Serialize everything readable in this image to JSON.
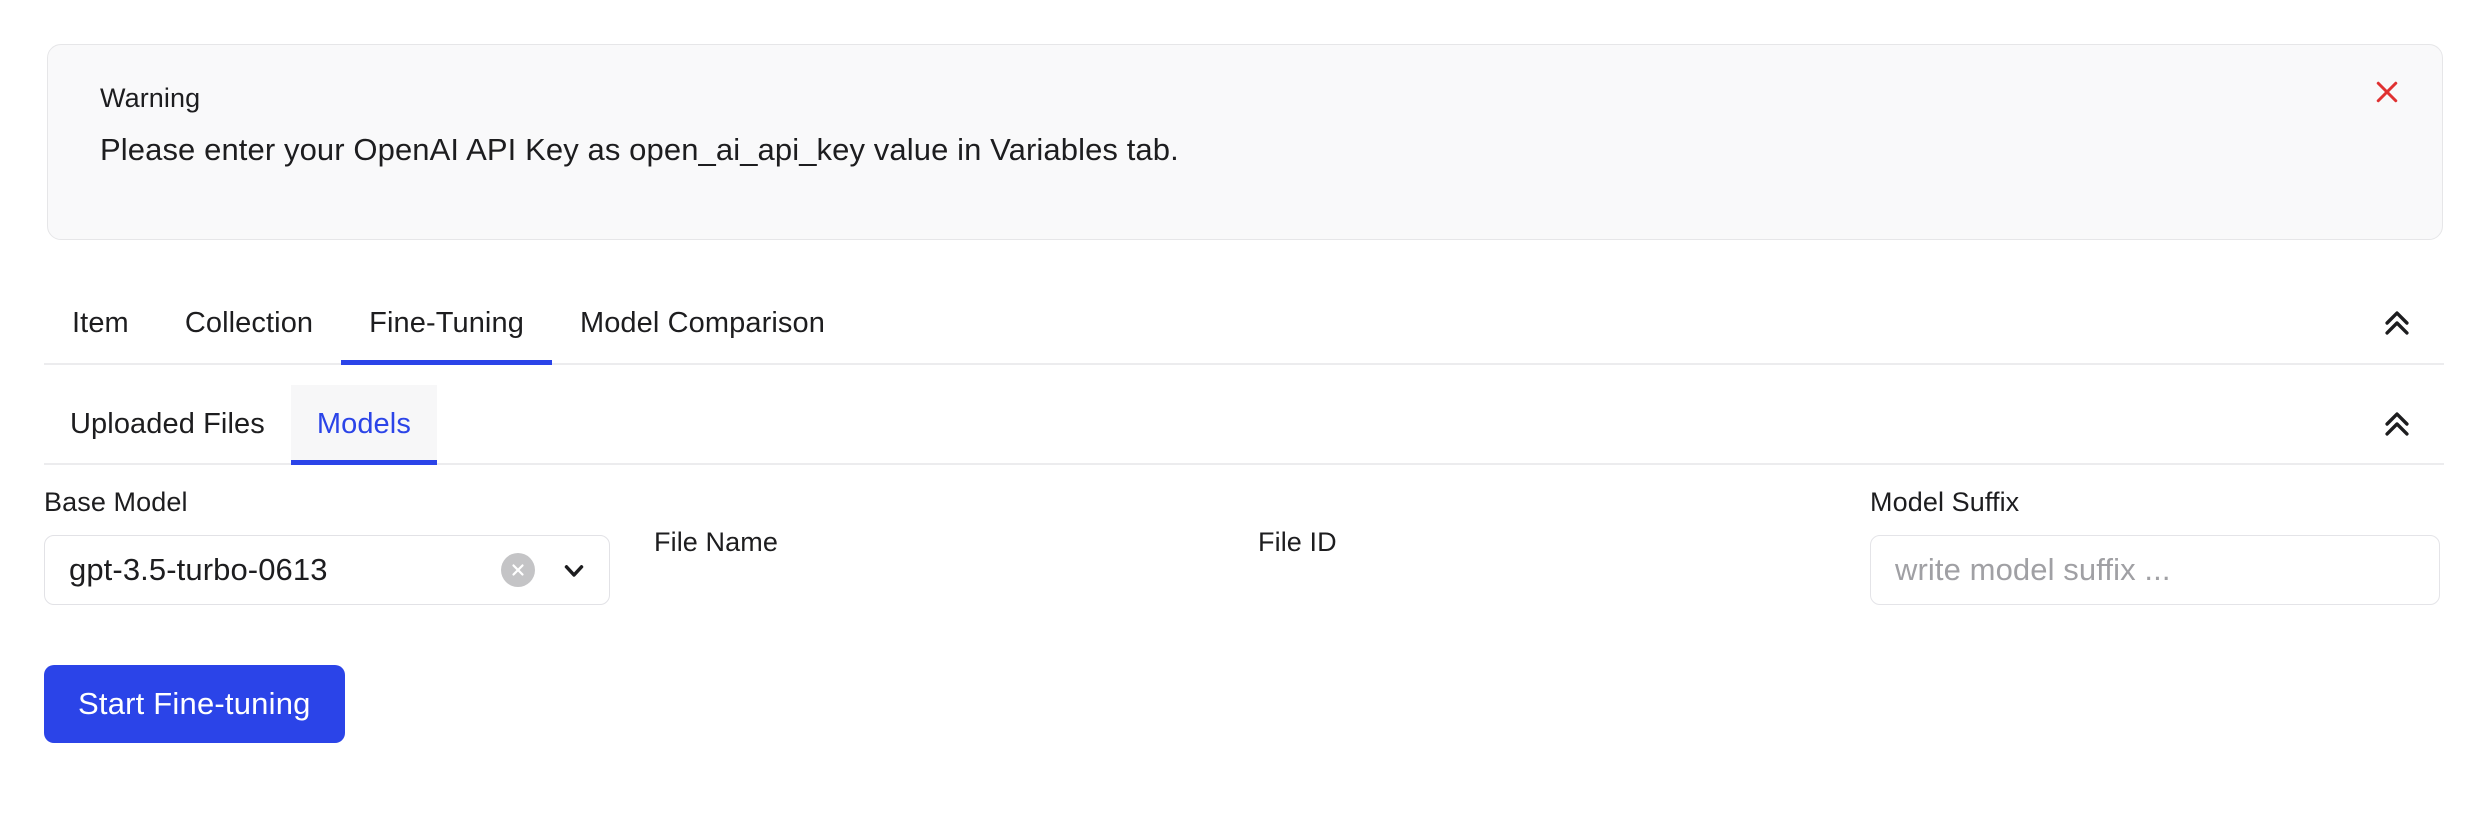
{
  "warning": {
    "title": "Warning",
    "message": "Please enter your OpenAI API Key as open_ai_api_key value in Variables tab.",
    "close_icon": "close-x-icon",
    "close_color": "#e03131",
    "background": "#f9f9fa",
    "border_color": "#e6e6e8"
  },
  "tabs": {
    "collapse_icon": "double-chevron-up-icon",
    "active_index": 2,
    "items": [
      {
        "label": "Item"
      },
      {
        "label": "Collection"
      },
      {
        "label": "Fine-Tuning"
      },
      {
        "label": "Model Comparison"
      }
    ]
  },
  "subtabs": {
    "collapse_icon": "double-chevron-up-icon",
    "active_index": 1,
    "items": [
      {
        "label": "Uploaded Files"
      },
      {
        "label": "Models"
      }
    ]
  },
  "form": {
    "base_model": {
      "label": "Base Model",
      "value": "gpt-3.5-turbo-0613",
      "clear_icon": "clear-circle-icon",
      "caret_icon": "chevron-down-icon"
    },
    "file_name": {
      "label": "File Name",
      "value": ""
    },
    "file_id": {
      "label": "File ID",
      "value": ""
    },
    "model_suffix": {
      "label": "Model Suffix",
      "value": "",
      "placeholder": "write model suffix ..."
    },
    "submit": {
      "label": "Start Fine-tuning"
    }
  },
  "theme": {
    "accent": "#2b44e8",
    "text": "#1d1d1f",
    "muted": "#a0a0a4",
    "divider": "#ececee"
  }
}
